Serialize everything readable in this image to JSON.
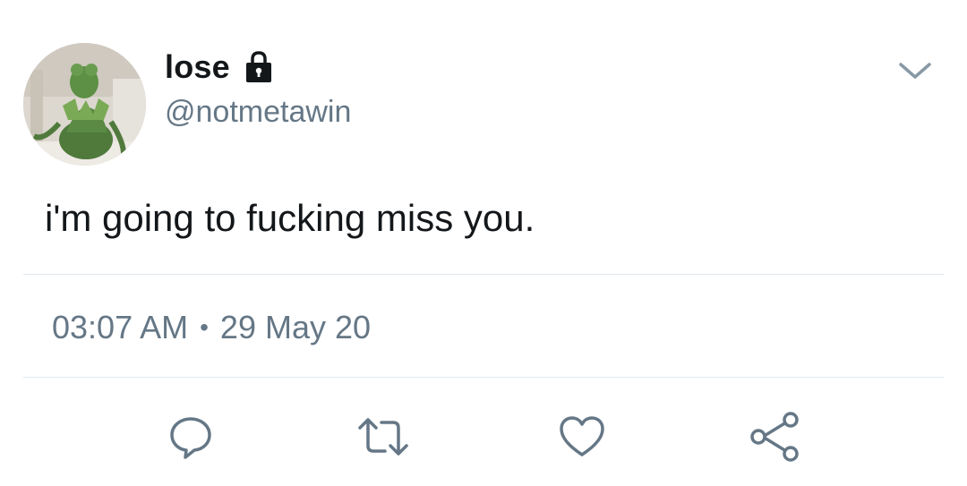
{
  "author": {
    "display_name": "lose",
    "handle": "@notmetawin",
    "avatar": "kermit-avatar-photo",
    "protected_icon": "lock-icon"
  },
  "tweet": {
    "text": "i'm going to fucking miss you.",
    "time": "03:07 AM",
    "separator": "•",
    "date": "29 May 20"
  },
  "menu_icon": "chevron-down-icon",
  "actions": [
    {
      "name": "reply",
      "icon": "reply-icon"
    },
    {
      "name": "retweet",
      "icon": "retweet-icon"
    },
    {
      "name": "like",
      "icon": "heart-icon"
    },
    {
      "name": "share",
      "icon": "share-icon"
    }
  ],
  "colors": {
    "text": "#14171a",
    "secondary": "#657786",
    "divider": "#e1e8ed",
    "background": "#ffffff"
  }
}
